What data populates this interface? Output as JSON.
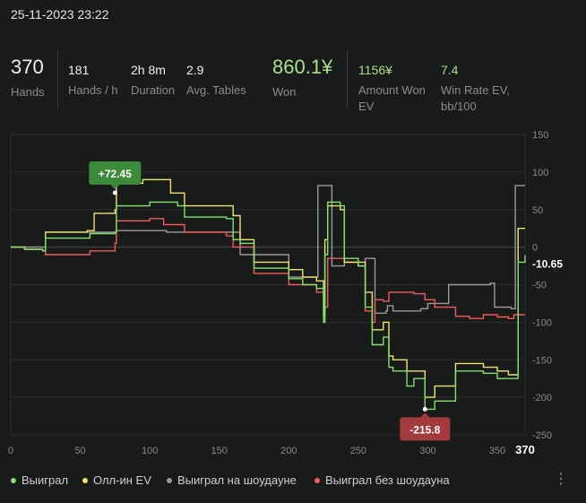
{
  "header": {
    "datetime": "25-11-2023 23:22"
  },
  "stats": {
    "hands": {
      "value": "370",
      "label": "Hands"
    },
    "hands_per_hour": {
      "value": "181",
      "label": "Hands / h"
    },
    "duration": {
      "value": "2h 8m",
      "label": "Duration"
    },
    "avg_tables": {
      "value": "2.9",
      "label": "Avg. Tables"
    },
    "won": {
      "value": "860.1¥",
      "label": "Won"
    },
    "amount_won_ev": {
      "value": "1156¥",
      "label1": "Amount Won",
      "label2": "EV"
    },
    "win_rate_ev": {
      "value": "7.4",
      "label1": "Win Rate EV,",
      "label2": "bb/100"
    }
  },
  "legend": {
    "won": "Выиграл",
    "allin_ev": "Олл-ин EV",
    "showdown": "Выиграл на шоудауне",
    "non_showdown": "Выиграл без шоудауна"
  },
  "colors": {
    "won": "#7ee36b",
    "allin_ev": "#f0e36a",
    "showdown": "#9a9a9a",
    "non_showdown": "#f25a57"
  },
  "chart_data": {
    "type": "line",
    "xlim": [
      0,
      370
    ],
    "ylim": [
      -250,
      150
    ],
    "x_ticks": [
      "0",
      "50",
      "100",
      "150",
      "200",
      "250",
      "300",
      "350"
    ],
    "x_last_label": "370",
    "y_ticks": [
      "150",
      "100",
      "50",
      "0",
      "-50",
      "-100",
      "-150",
      "-200",
      "-250"
    ],
    "current_value_label": "-10.65",
    "max_callout": {
      "x": 75,
      "y": 72.45,
      "label": "+72.45"
    },
    "min_callout": {
      "x": 298,
      "y": -215.8,
      "label": "-215.8"
    },
    "series": [
      {
        "name": "Выиграл",
        "key": "won",
        "points": [
          [
            0,
            0
          ],
          [
            10,
            -3
          ],
          [
            23,
            -5
          ],
          [
            25,
            12
          ],
          [
            50,
            12
          ],
          [
            57,
            18
          ],
          [
            75,
            20
          ],
          [
            76,
            55
          ],
          [
            100,
            60
          ],
          [
            120,
            55
          ],
          [
            125,
            40
          ],
          [
            155,
            38
          ],
          [
            160,
            10
          ],
          [
            165,
            5
          ],
          [
            175,
            -28
          ],
          [
            200,
            -42
          ],
          [
            210,
            -50
          ],
          [
            220,
            -55
          ],
          [
            225,
            -100
          ],
          [
            226,
            -10
          ],
          [
            228,
            60
          ],
          [
            237,
            55
          ],
          [
            240,
            -15
          ],
          [
            250,
            -25
          ],
          [
            255,
            -80
          ],
          [
            260,
            -130
          ],
          [
            268,
            -120
          ],
          [
            272,
            -160
          ],
          [
            275,
            -165
          ],
          [
            285,
            -185
          ],
          [
            290,
            -175
          ],
          [
            298,
            -215.8
          ],
          [
            305,
            -205
          ],
          [
            320,
            -165
          ],
          [
            340,
            -168
          ],
          [
            350,
            -175
          ],
          [
            358,
            -175
          ],
          [
            365,
            -20
          ],
          [
            370,
            -10.65
          ]
        ]
      },
      {
        "name": "Олл-ин EV",
        "key": "allin_ev",
        "points": [
          [
            0,
            0
          ],
          [
            10,
            -3
          ],
          [
            23,
            -5
          ],
          [
            25,
            20
          ],
          [
            55,
            22
          ],
          [
            60,
            45
          ],
          [
            75,
            50
          ],
          [
            76,
            85
          ],
          [
            95,
            90
          ],
          [
            115,
            72
          ],
          [
            125,
            55
          ],
          [
            160,
            42
          ],
          [
            165,
            10
          ],
          [
            175,
            -20
          ],
          [
            200,
            -30
          ],
          [
            210,
            -40
          ],
          [
            220,
            -45
          ],
          [
            225,
            -90
          ],
          [
            226,
            10
          ],
          [
            228,
            55
          ],
          [
            237,
            50
          ],
          [
            240,
            -20
          ],
          [
            250,
            -20
          ],
          [
            255,
            -60
          ],
          [
            260,
            -110
          ],
          [
            268,
            -100
          ],
          [
            272,
            -145
          ],
          [
            275,
            -150
          ],
          [
            285,
            -165
          ],
          [
            298,
            -200
          ],
          [
            305,
            -185
          ],
          [
            320,
            -155
          ],
          [
            340,
            -160
          ],
          [
            350,
            -165
          ],
          [
            358,
            -170
          ],
          [
            365,
            25
          ],
          [
            370,
            25
          ]
        ]
      },
      {
        "name": "Выиграл на шоудауне",
        "key": "showdown",
        "points": [
          [
            0,
            0
          ],
          [
            23,
            0
          ],
          [
            25,
            20
          ],
          [
            60,
            20
          ],
          [
            75,
            20
          ],
          [
            76,
            22
          ],
          [
            110,
            22
          ],
          [
            112,
            20
          ],
          [
            140,
            20
          ],
          [
            160,
            20
          ],
          [
            165,
            -10
          ],
          [
            200,
            -40
          ],
          [
            210,
            -40
          ],
          [
            220,
            -40
          ],
          [
            221,
            82
          ],
          [
            230,
            82
          ],
          [
            231,
            -25
          ],
          [
            240,
            -20
          ],
          [
            250,
            -25
          ],
          [
            255,
            -15
          ],
          [
            260,
            -15
          ],
          [
            262,
            -88
          ],
          [
            270,
            -85
          ],
          [
            271,
            -78
          ],
          [
            275,
            -85
          ],
          [
            290,
            -85
          ],
          [
            295,
            -82
          ],
          [
            300,
            -75
          ],
          [
            310,
            -75
          ],
          [
            315,
            -50
          ],
          [
            345,
            -48
          ],
          [
            348,
            -80
          ],
          [
            360,
            -82
          ],
          [
            363,
            82
          ],
          [
            370,
            82
          ]
        ]
      },
      {
        "name": "Выиграл без шоудауна",
        "key": "non_showdown",
        "points": [
          [
            0,
            0
          ],
          [
            10,
            -3
          ],
          [
            23,
            -5
          ],
          [
            25,
            -10
          ],
          [
            50,
            -10
          ],
          [
            57,
            -5
          ],
          [
            75,
            5
          ],
          [
            76,
            35
          ],
          [
            100,
            38
          ],
          [
            110,
            30
          ],
          [
            125,
            20
          ],
          [
            155,
            15
          ],
          [
            160,
            0
          ],
          [
            175,
            -35
          ],
          [
            200,
            -50
          ],
          [
            220,
            -60
          ],
          [
            225,
            -80
          ],
          [
            228,
            -15
          ],
          [
            240,
            -20
          ],
          [
            250,
            -25
          ],
          [
            255,
            -85
          ],
          [
            260,
            -100
          ],
          [
            262,
            -70
          ],
          [
            268,
            -72
          ],
          [
            272,
            -60
          ],
          [
            290,
            -62
          ],
          [
            298,
            -70
          ],
          [
            305,
            -80
          ],
          [
            320,
            -92
          ],
          [
            330,
            -95
          ],
          [
            340,
            -90
          ],
          [
            350,
            -93
          ],
          [
            358,
            -95
          ],
          [
            362,
            -90
          ],
          [
            370,
            -90
          ]
        ]
      }
    ]
  }
}
